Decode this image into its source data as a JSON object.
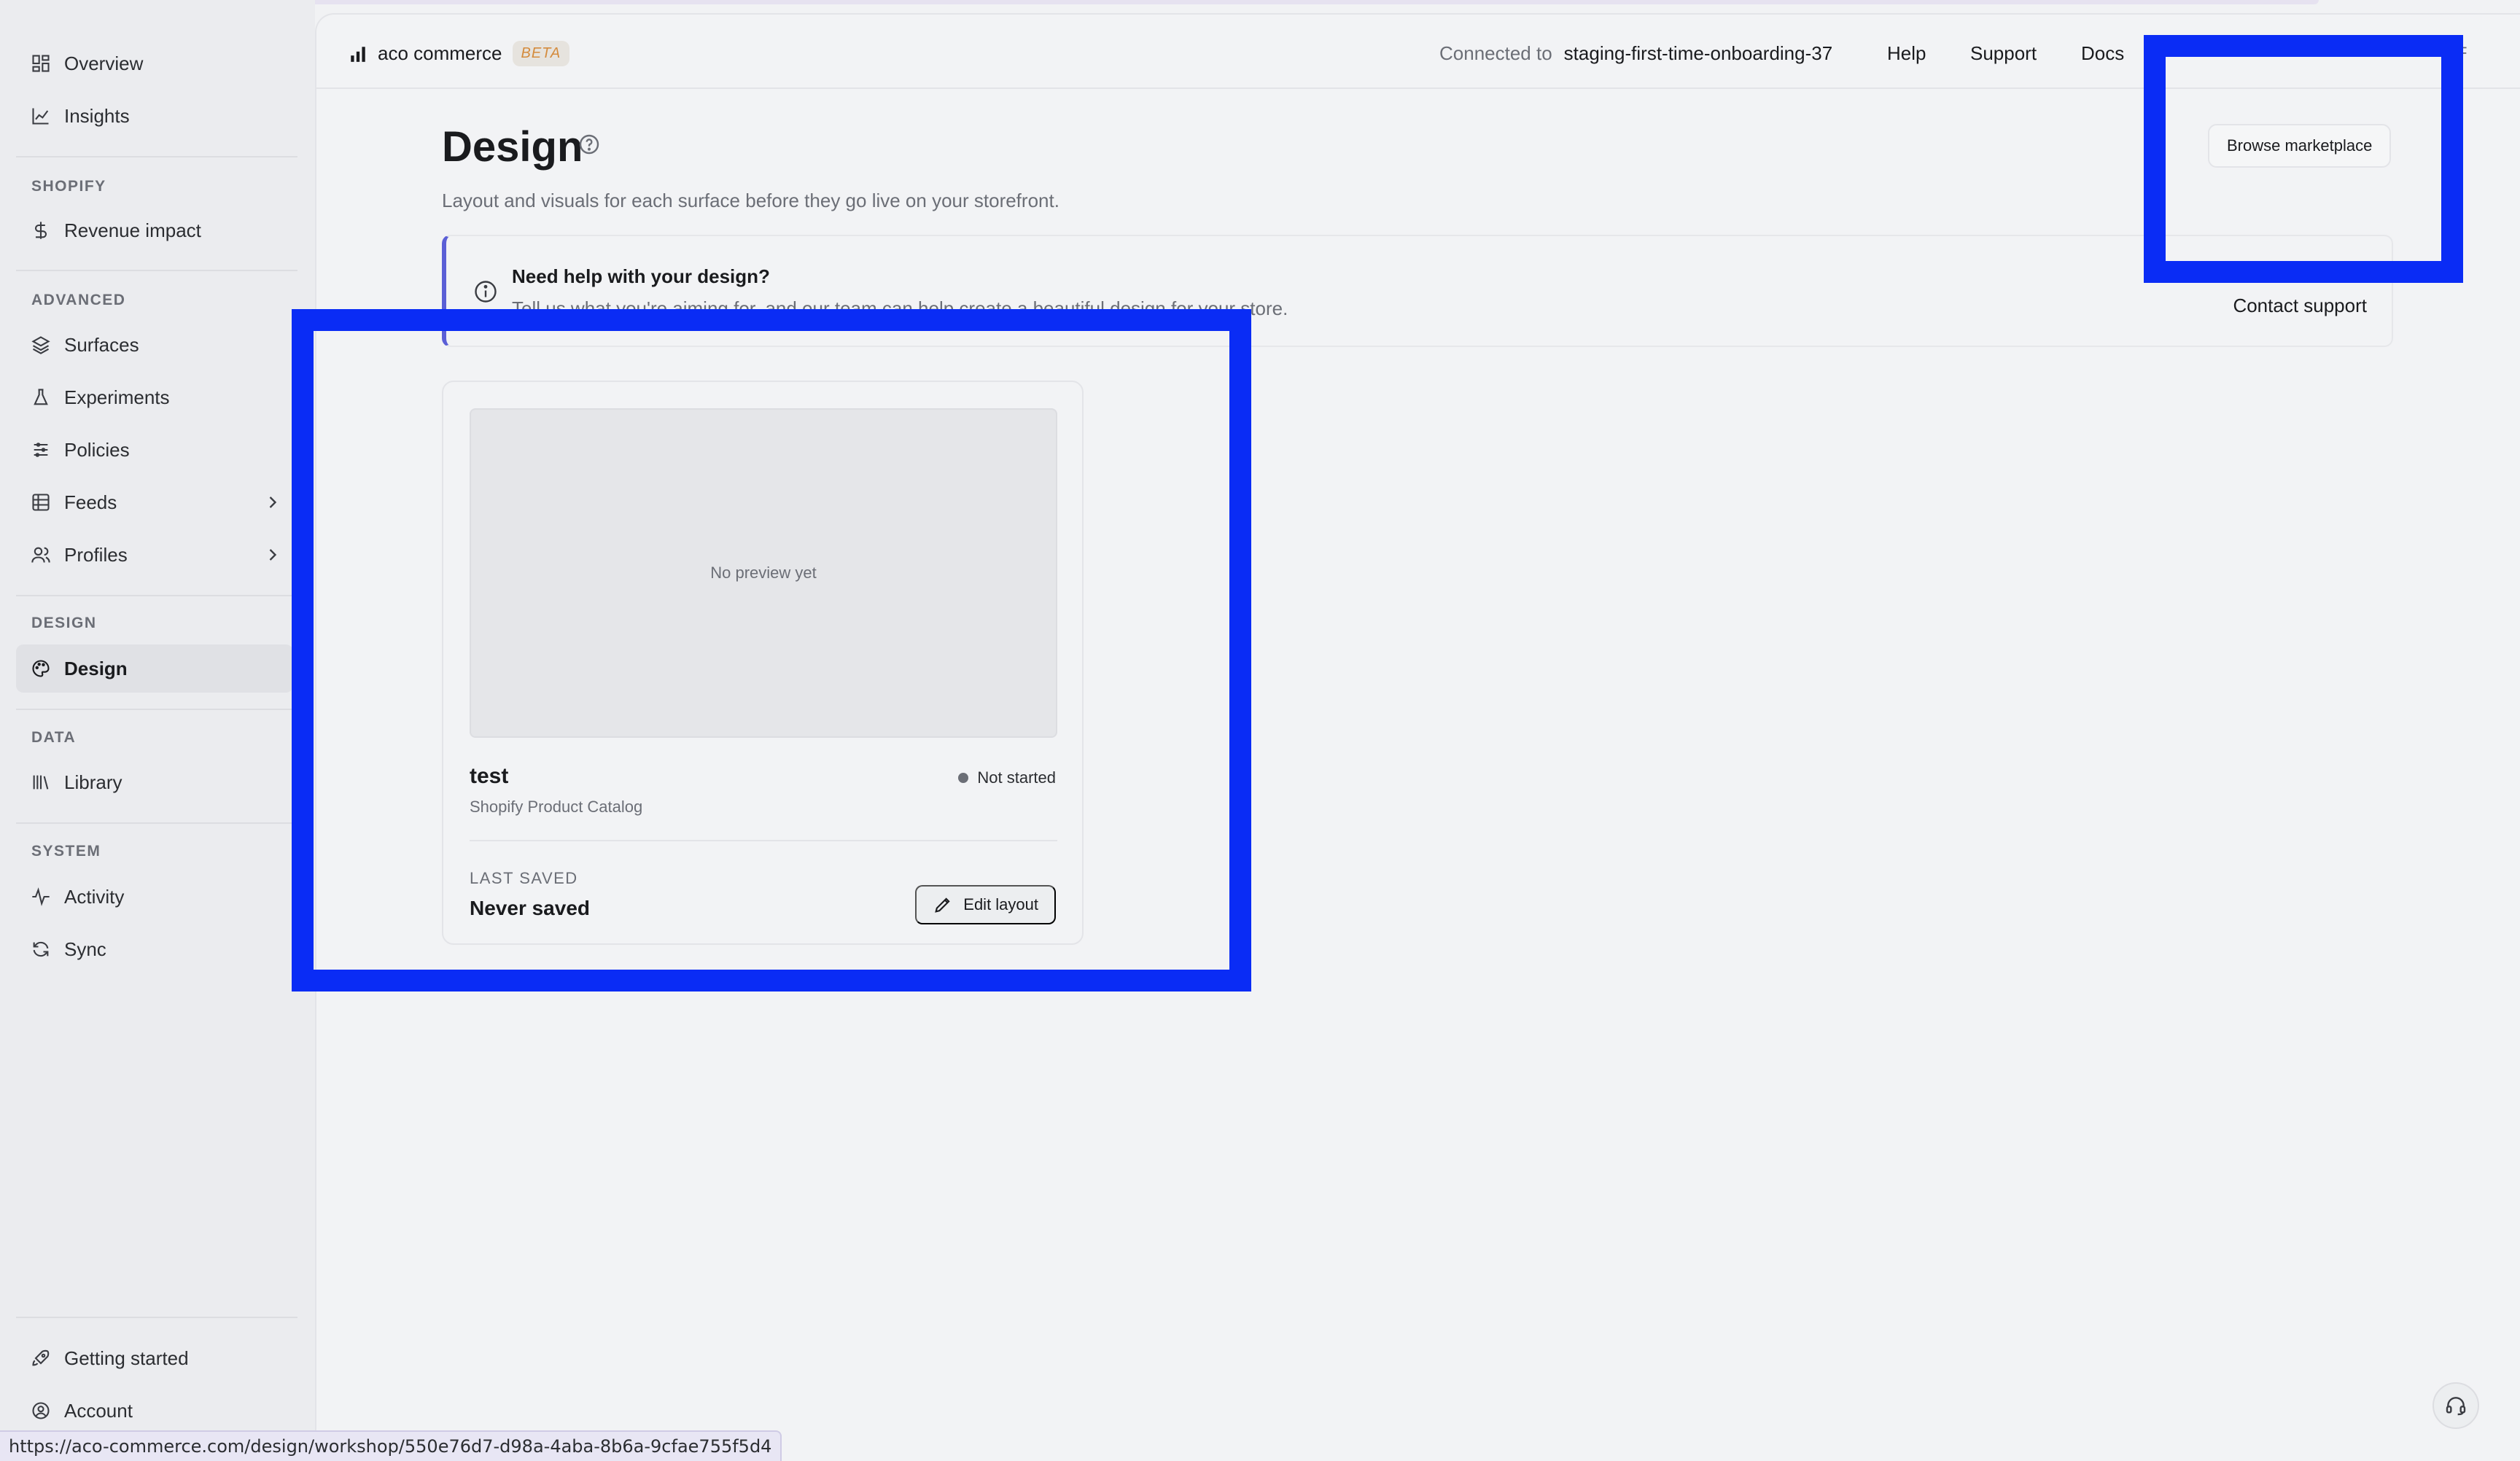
{
  "sidebar": {
    "top_items": [
      {
        "label": "Overview",
        "icon": "grid-icon"
      },
      {
        "label": "Insights",
        "icon": "chart-line-icon"
      }
    ],
    "sections": [
      {
        "label": "SHOPIFY",
        "items": [
          {
            "label": "Revenue impact",
            "icon": "dollar-icon"
          }
        ]
      },
      {
        "label": "ADVANCED",
        "items": [
          {
            "label": "Surfaces",
            "icon": "layers-icon"
          },
          {
            "label": "Experiments",
            "icon": "flask-icon"
          },
          {
            "label": "Policies",
            "icon": "sliders-icon"
          },
          {
            "label": "Feeds",
            "icon": "table-icon"
          },
          {
            "label": "Profiles",
            "icon": "users-icon"
          }
        ]
      },
      {
        "label": "DESIGN",
        "items": [
          {
            "label": "Design",
            "icon": "palette-icon",
            "active": true
          }
        ]
      },
      {
        "label": "DATA",
        "items": [
          {
            "label": "Library",
            "icon": "library-icon"
          }
        ]
      },
      {
        "label": "SYSTEM",
        "items": [
          {
            "label": "Activity",
            "icon": "activity-icon"
          },
          {
            "label": "Sync",
            "icon": "refresh-icon"
          }
        ]
      }
    ],
    "bottom_items": [
      {
        "label": "Getting started",
        "icon": "rocket-icon"
      },
      {
        "label": "Account",
        "icon": "user-circle-icon"
      }
    ]
  },
  "topbar": {
    "brand": "aco commerce",
    "beta": "BETA",
    "connected_label": "Connected to",
    "connected_value": "staging-first-time-onboarding-37",
    "links": [
      "Help",
      "Support",
      "Docs"
    ],
    "avatar_letter": "F"
  },
  "page": {
    "title": "Design",
    "subtitle": "Layout and visuals for each surface before they go live on your storefront.",
    "browse_button": "Browse marketplace"
  },
  "banner": {
    "title": "Need help with your design?",
    "text": "Tell us what you're aiming for, and our team can help create a beautiful design for your store.",
    "contact": "Contact support"
  },
  "card": {
    "preview_text": "No preview yet",
    "name": "test",
    "source": "Shopify Product Catalog",
    "status": "Not started",
    "last_saved_label": "LAST SAVED",
    "last_saved_value": "Never saved",
    "edit_button": "Edit layout"
  },
  "statusbar": {
    "url": "https://aco-commerce.com/design/workshop/550e76d7-d98a-4aba-8b6a-9cfae755f5d4"
  },
  "colors": {
    "highlight": "#0a2cf5",
    "accent": "#5b5fd6",
    "beta": "#d48b3d"
  }
}
